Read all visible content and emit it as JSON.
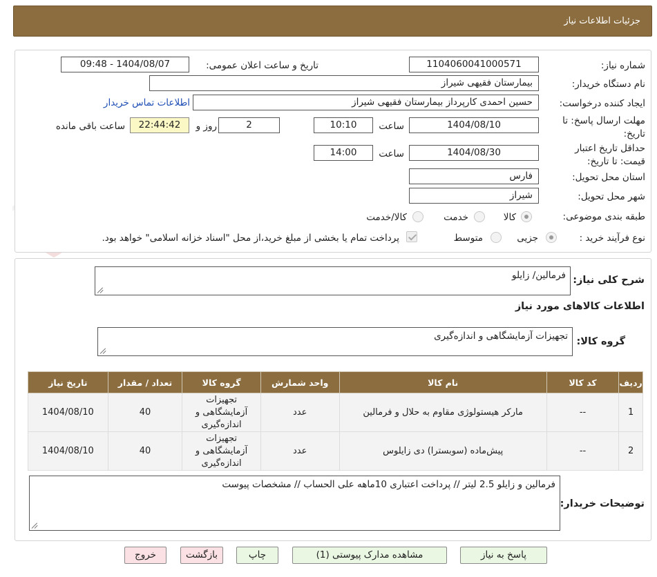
{
  "header": {
    "title": "جزئیات اطلاعات نیاز"
  },
  "watermark": {
    "text": "AriaTender.neT"
  },
  "form": {
    "need_number": {
      "label": "شماره نیاز:",
      "value": "1104060041000571"
    },
    "announce": {
      "label": "تاریخ و ساعت اعلان عمومی:",
      "value": "1404/08/07 - 09:48"
    },
    "buyer": {
      "label": "نام دستگاه خریدار:",
      "value": "بیمارستان فقیهی شیراز"
    },
    "creator": {
      "label": "ایجاد کننده درخواست:",
      "value": "حسین احمدی کارپرداز بیمارستان فقیهی شیراز",
      "contact_link": "اطلاعات تماس خریدار"
    },
    "deadline": {
      "label": "مهلت ارسال پاسخ: تا تاریخ:",
      "date": "1404/08/10",
      "time_label": "ساعت",
      "time": "10:10",
      "days": "2",
      "days_label": "روز و",
      "remaining": "22:44:42",
      "remaining_label": "ساعت باقی مانده"
    },
    "validity": {
      "label": "حداقل تاریخ اعتبار قیمت: تا تاریخ:",
      "date": "1404/08/30",
      "time_label": "ساعت",
      "time": "14:00"
    },
    "province": {
      "label": "استان محل تحویل:",
      "value": "فارس"
    },
    "city": {
      "label": "شهر محل تحویل:",
      "value": "شیراز"
    },
    "category": {
      "label": "طبقه بندی موضوعی:",
      "options": [
        "کالا",
        "خدمت",
        "کالا/خدمت"
      ],
      "selected": "کالا"
    },
    "process": {
      "label": "نوع فرآیند خرید :",
      "options": [
        "جزیی",
        "متوسط"
      ],
      "note": "پرداخت تمام یا بخشی از مبلغ خرید،از محل \"اسناد خزانه اسلامی\" خواهد بود."
    }
  },
  "summary": {
    "label": "شرح کلی نیاز:",
    "value": "فرمالین/ زایلو"
  },
  "goods": {
    "section_title": "اطلاعات کالاهای مورد نیاز",
    "group_label": "گروه کالا:",
    "group_value": "تجهیزات آزمایشگاهی و اندازه‌گیری",
    "columns": [
      "ردیف",
      "کد کالا",
      "نام کالا",
      "واحد شمارش",
      "گروه کالا",
      "تعداد / مقدار",
      "تاریخ نیاز"
    ],
    "rows": [
      {
        "row": "1",
        "code": "--",
        "name": "مارکر هیستولوژی مقاوم به حلال و فرمالین",
        "unit": "عدد",
        "group": "تجهیزات آزمایشگاهی و اندازه‌گیری",
        "qty": "40",
        "date": "1404/08/10"
      },
      {
        "row": "2",
        "code": "--",
        "name": "پیش‌ماده (سوبسترا) دی زایلوس",
        "unit": "عدد",
        "group": "تجهیزات آزمایشگاهی و اندازه‌گیری",
        "qty": "40",
        "date": "1404/08/10"
      }
    ]
  },
  "buyer_notes": {
    "label": "توضیحات خریدار:",
    "value": "فرمالین و زایلو 2.5 لیتر // پرداخت اعتباری 10ماهه علی الحساب // مشخصات پیوست"
  },
  "buttons": {
    "reply": "پاسخ به نیاز",
    "attachments": "مشاهده مدارک پیوستی (1)",
    "print": "چاپ",
    "back": "بازگشت",
    "exit": "خروج"
  }
}
